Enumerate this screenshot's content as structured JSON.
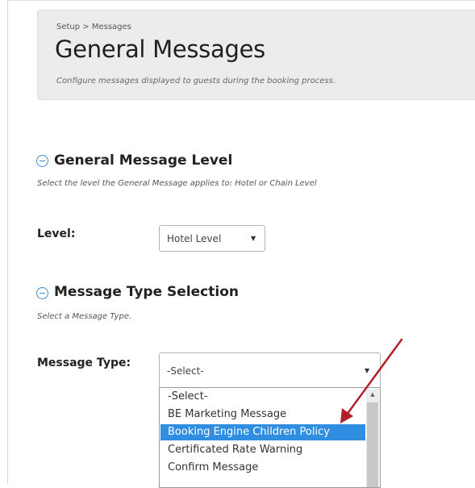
{
  "header": {
    "breadcrumb": "Setup > Messages",
    "title": "General Messages",
    "subtitle": "Configure messages displayed to guests during the booking process."
  },
  "level_section": {
    "title": "General Message Level",
    "description": "Select the level the General Message applies to: Hotel or Chain Level",
    "field_label": "Level:",
    "selected": "Hotel Level",
    "icon": "collapse-minus-icon"
  },
  "type_section": {
    "title": "Message Type Selection",
    "description": "Select a Message Type.",
    "field_label": "Message Type:",
    "selected": "-Select-",
    "icon": "collapse-minus-icon",
    "options": [
      "-Select-",
      "BE Marketing Message",
      "Booking Engine Children Policy",
      "Certificated Rate Warning",
      "Confirm Message"
    ],
    "highlighted_option": "Booking Engine Children Policy"
  },
  "colors": {
    "accent": "#3d8fd0",
    "highlight": "#2f8ee0",
    "annotation_arrow": "#b3202a"
  }
}
